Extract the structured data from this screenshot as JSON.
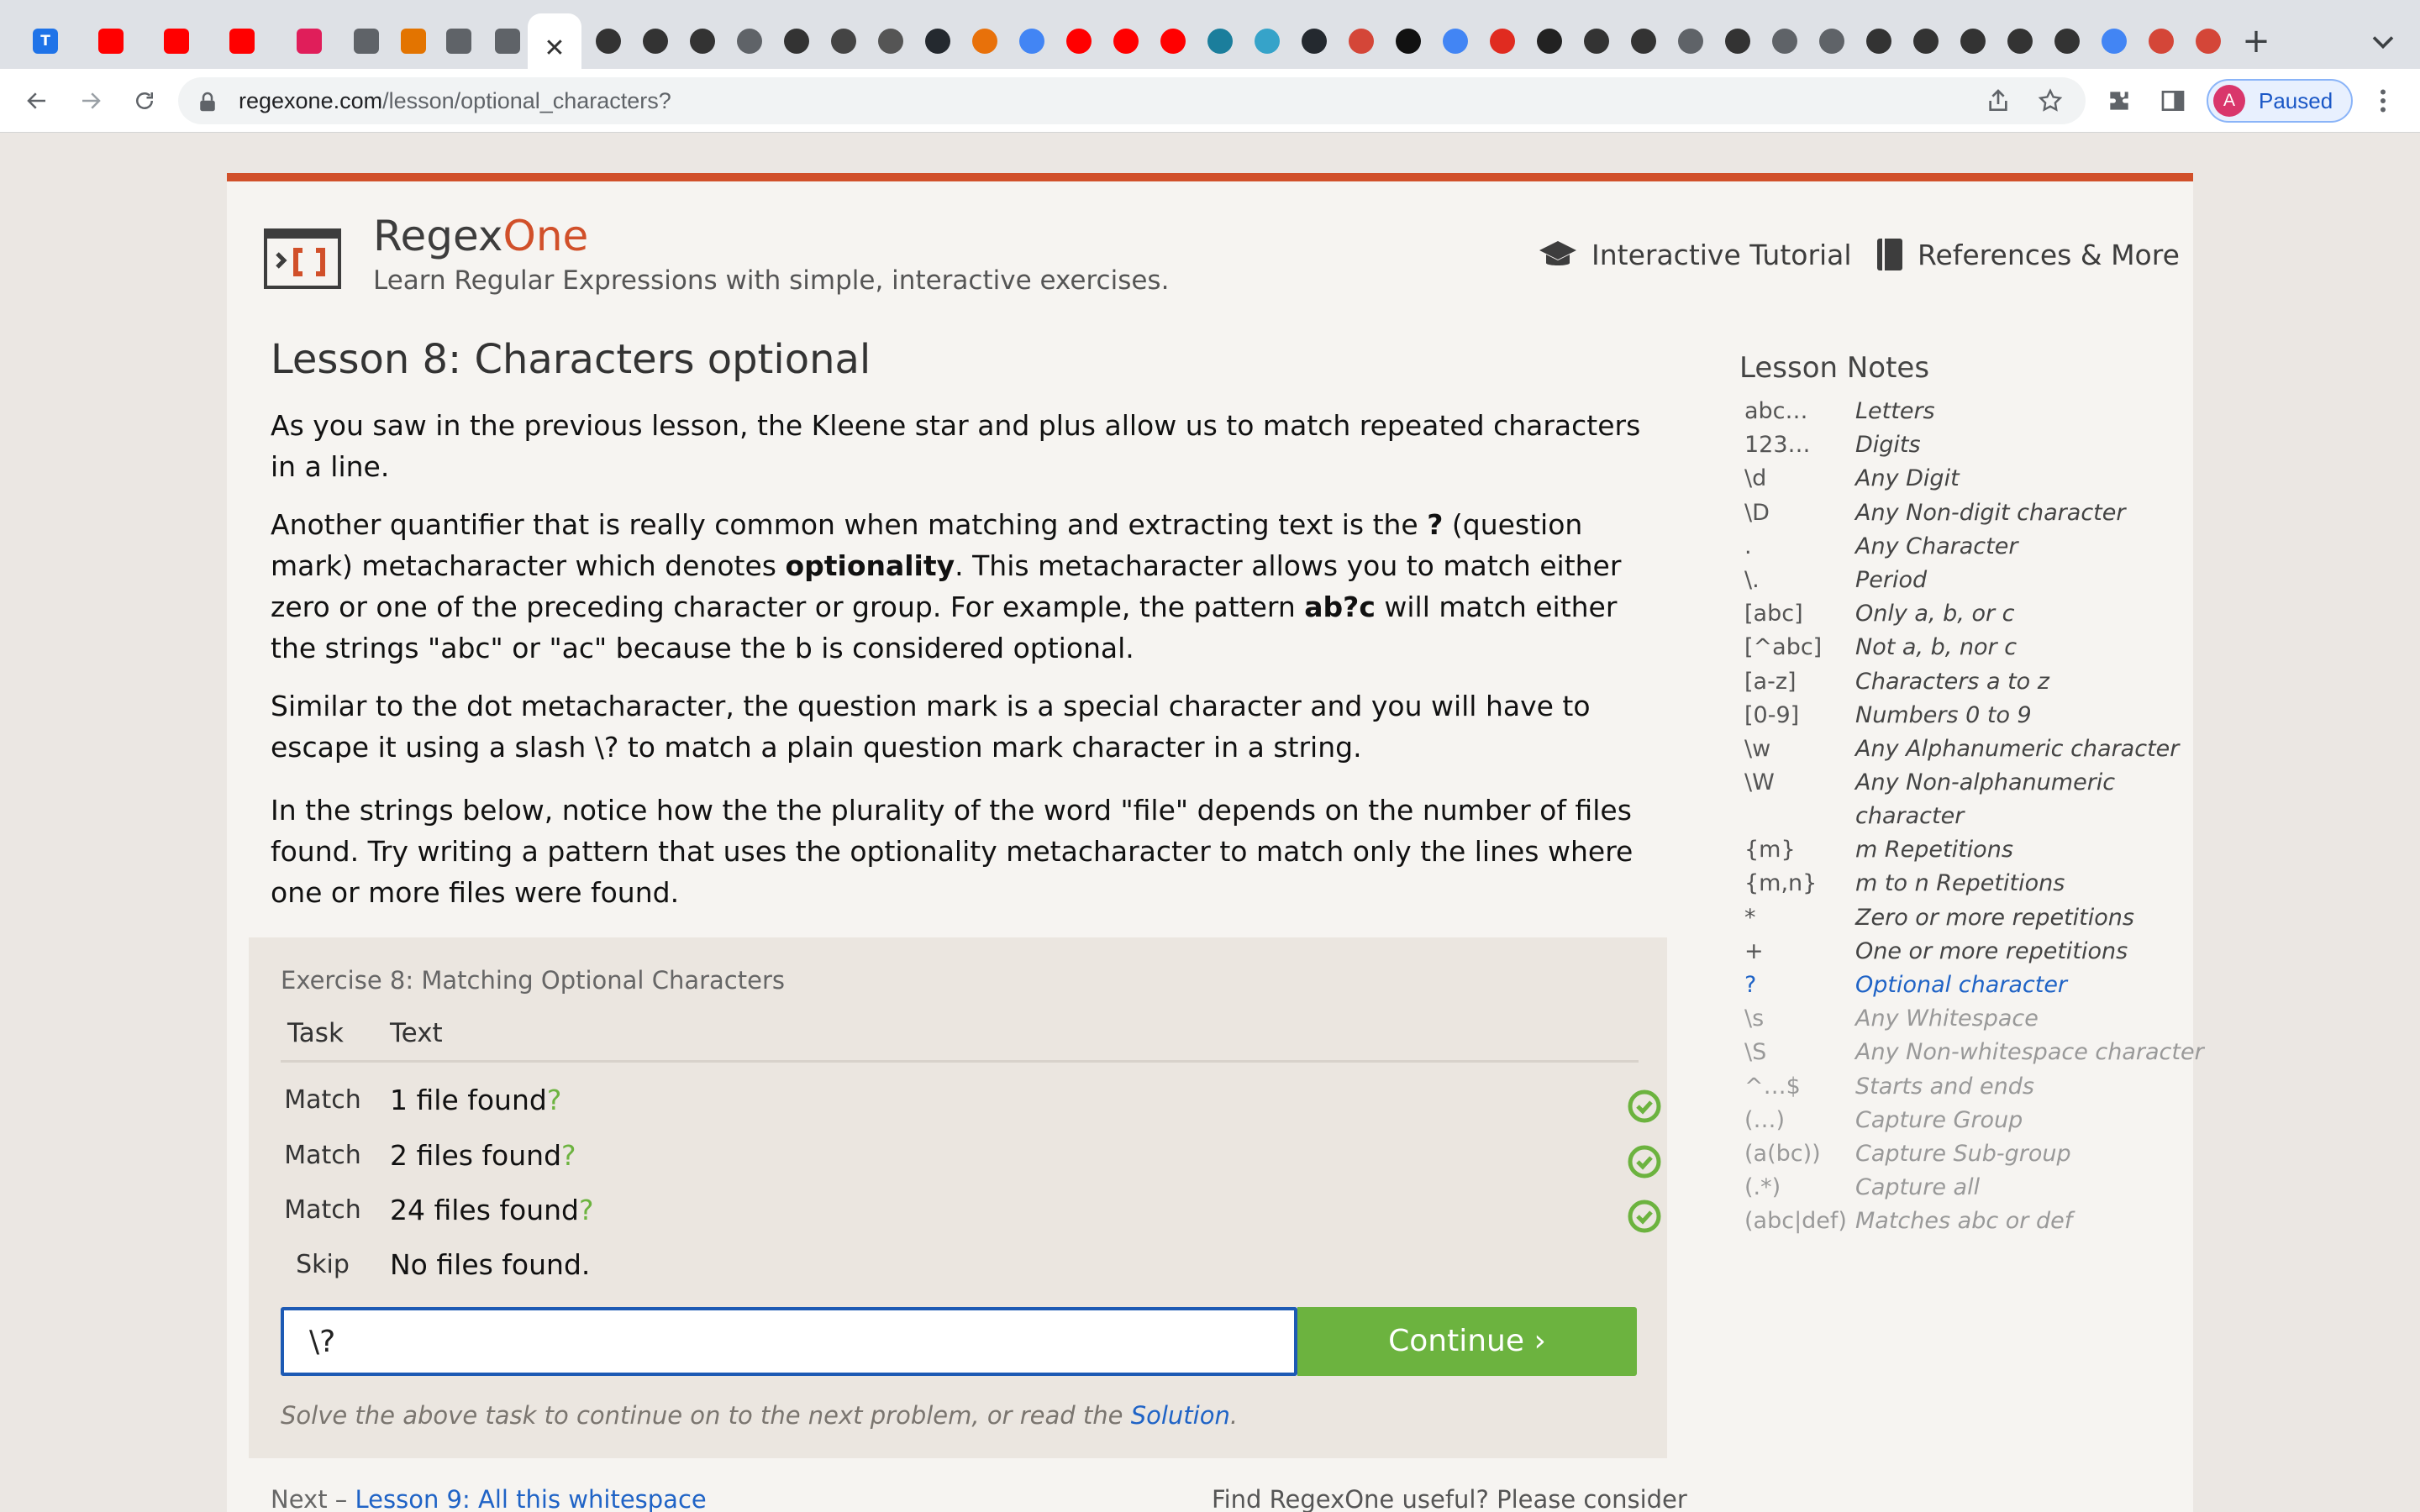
{
  "browser": {
    "tabs": [
      {
        "name": "T",
        "color": "#1f73e8",
        "icon": "typora-icon"
      },
      {
        "name": "",
        "color": "#ff0000",
        "icon": "youtube-icon"
      },
      {
        "name": "",
        "color": "#ff0000",
        "icon": "youtube-icon"
      },
      {
        "name": "",
        "color": "#ff0000",
        "icon": "youtube-icon"
      },
      {
        "name": "",
        "color": "#e01e5a",
        "icon": "slack-icon"
      },
      {
        "name": "",
        "color": "#5f6368",
        "icon": "globe-icon"
      },
      {
        "name": "",
        "color": "#e37400",
        "icon": "calendar-icon"
      },
      {
        "name": "",
        "color": "#5f6368",
        "icon": "globe-icon"
      },
      {
        "name": "",
        "color": "#5f6368",
        "icon": "globe-icon"
      }
    ],
    "active_tab_close": "✕",
    "new_tab": "+",
    "url_domain": "regexone.com",
    "url_path": "/lesson/optional_characters?",
    "profile_initial": "A",
    "profile_status": "Paused"
  },
  "site": {
    "brand_regex": "Regex",
    "brand_one": "One",
    "tagline": "Learn Regular Expressions with simple, interactive exercises.",
    "nav_tutorial": "Interactive Tutorial",
    "nav_references": "References & More"
  },
  "lesson": {
    "title": "Lesson 8: Characters optional",
    "p1": "As you saw in the previous lesson, the Kleene star and plus allow us to match repeated characters in a line.",
    "p2_a": "Another quantifier that is really common when matching and extracting text is the ",
    "p2_q": "?",
    "p2_b": " (question mark) metacharacter which denotes ",
    "p2_opt": "optionality",
    "p2_c": ". This metacharacter allows you to match either zero or one of the preceding character or group. For example, the pattern ",
    "p2_pat": "ab?c",
    "p2_d": " will match either the strings \"abc\" or \"ac\" because the b is considered optional.",
    "p3": "Similar to the dot metacharacter, the question mark is a special character and you will have to escape it using a slash \\? to match a plain question mark character in a string.",
    "p4": "In the strings below, notice how the the plurality of the word \"file\" depends on the number of files found. Try writing a pattern that uses the optionality metacharacter to match only the lines where one or more files were found."
  },
  "exercise": {
    "title": "Exercise 8: Matching Optional Characters",
    "col_task": "Task",
    "col_text": "Text",
    "rows": [
      {
        "task": "Match",
        "text": "1 file found",
        "hl": "?",
        "done": true
      },
      {
        "task": "Match",
        "text": "2 files found",
        "hl": "?",
        "done": true
      },
      {
        "task": "Match",
        "text": "24 files found",
        "hl": "?",
        "done": true
      },
      {
        "task": "Skip",
        "text": "No files found.",
        "hl": "",
        "done": false
      }
    ],
    "input_value": "\\?",
    "continue": "Continue ›",
    "hint_text": "Solve the above task to continue on to the next problem, or read the ",
    "hint_link": "Solution",
    "hint_end": "."
  },
  "footer": {
    "next_prefix": "Next – ",
    "next_link": "Lesson 9: All this whitespace",
    "useful": "Find RegexOne useful? Please consider"
  },
  "notes": {
    "title": "Lesson Notes",
    "items": [
      {
        "k": "abc…",
        "v": "Letters",
        "state": "done"
      },
      {
        "k": "123…",
        "v": "Digits",
        "state": "done"
      },
      {
        "k": "\\d",
        "v": "Any Digit",
        "state": "done"
      },
      {
        "k": "\\D",
        "v": "Any Non-digit character",
        "state": "done"
      },
      {
        "k": ".",
        "v": "Any Character",
        "state": "done"
      },
      {
        "k": "\\.",
        "v": "Period",
        "state": "done"
      },
      {
        "k": "[abc]",
        "v": "Only a, b, or c",
        "state": "done"
      },
      {
        "k": "[^abc]",
        "v": "Not a, b, nor c",
        "state": "done"
      },
      {
        "k": "[a-z]",
        "v": "Characters a to z",
        "state": "done"
      },
      {
        "k": "[0-9]",
        "v": "Numbers 0 to 9",
        "state": "done"
      },
      {
        "k": "\\w",
        "v": "Any Alphanumeric character",
        "state": "done"
      },
      {
        "k": "\\W",
        "v": "Any Non-alphanumeric character",
        "state": "done"
      },
      {
        "k": "{m}",
        "v": "m Repetitions",
        "state": "done"
      },
      {
        "k": "{m,n}",
        "v": "m to n Repetitions",
        "state": "done"
      },
      {
        "k": "*",
        "v": "Zero or more repetitions",
        "state": "done"
      },
      {
        "k": "+",
        "v": "One or more repetitions",
        "state": "done"
      },
      {
        "k": "?",
        "v": "Optional character",
        "state": "active"
      },
      {
        "k": "\\s",
        "v": "Any Whitespace",
        "state": "future"
      },
      {
        "k": "\\S",
        "v": "Any Non-whitespace character",
        "state": "future"
      },
      {
        "k": "^…$",
        "v": "Starts and ends",
        "state": "future"
      },
      {
        "k": "(…)",
        "v": "Capture Group",
        "state": "future"
      },
      {
        "k": "(a(bc))",
        "v": "Capture Sub-group",
        "state": "future"
      },
      {
        "k": "(.*)",
        "v": "Capture all",
        "state": "future"
      },
      {
        "k": "(abc|def)",
        "v": "Matches abc or def",
        "state": "future"
      }
    ]
  }
}
